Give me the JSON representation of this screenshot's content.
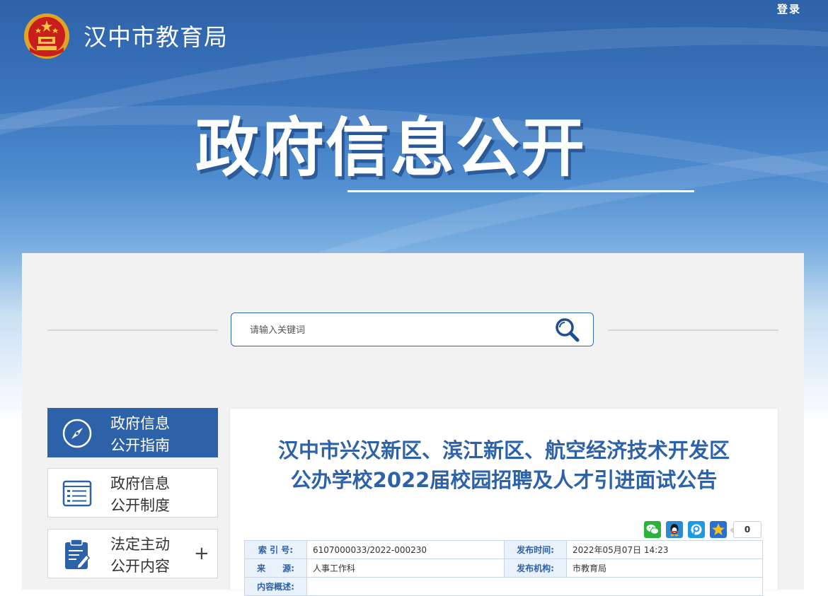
{
  "header": {
    "site_name": "汉中市教育局",
    "login": "登录",
    "hero_title": "政府信息公开"
  },
  "search": {
    "placeholder": "请输入关键词"
  },
  "sidebar": {
    "items": [
      {
        "line1": "政府信息",
        "line2": "公开指南",
        "icon": "compass-icon",
        "active": true
      },
      {
        "line1": "政府信息",
        "line2": "公开制度",
        "icon": "document-list-icon",
        "active": false
      },
      {
        "line1": "法定主动",
        "line2": "公开内容",
        "icon": "clipboard-edit-icon",
        "active": false,
        "expand": "+"
      }
    ]
  },
  "article": {
    "title_line1": "汉中市兴汉新区、滨江新区、航空经济技术开发区",
    "title_line2": "公办学校2022届校园招聘及人才引进面试公告",
    "share": {
      "icons": [
        "wechat-icon",
        "qq-icon",
        "pinterest-icon",
        "qzone-icon"
      ],
      "count": "0"
    },
    "meta": {
      "index_label": "索 引 号:",
      "index_value": "6107000033/2022-000230",
      "date_label": "发布时间:",
      "date_value": "2022年05月07日 14:23",
      "source_label": "来　　源:",
      "source_value": "人事工作科",
      "org_label": "发布机构:",
      "org_value": "市教育局",
      "summary_label": "内容概述:"
    }
  },
  "colors": {
    "brand_blue": "#2e62a8",
    "panel_bg": "#f2f2f2",
    "meta_label_bg": "#e9f1fb"
  }
}
